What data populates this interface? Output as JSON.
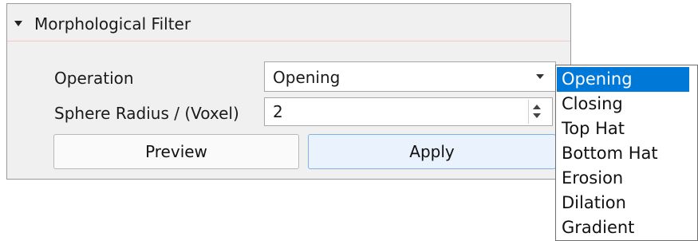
{
  "panel": {
    "title": "Morphological Filter",
    "operation_label": "Operation",
    "operation_value": "Opening",
    "radius_label": "Sphere Radius / (Voxel)",
    "radius_value": "2",
    "preview_label": "Preview",
    "apply_label": "Apply"
  },
  "dropdown": {
    "items": [
      "Opening",
      "Closing",
      "Top Hat",
      "Bottom Hat",
      "Erosion",
      "Dilation",
      "Gradient"
    ],
    "selected": "Opening"
  },
  "colors": {
    "selection": "#0078d7",
    "header_underline": "#f2c8c8",
    "apply_border": "#7fb2e5"
  }
}
